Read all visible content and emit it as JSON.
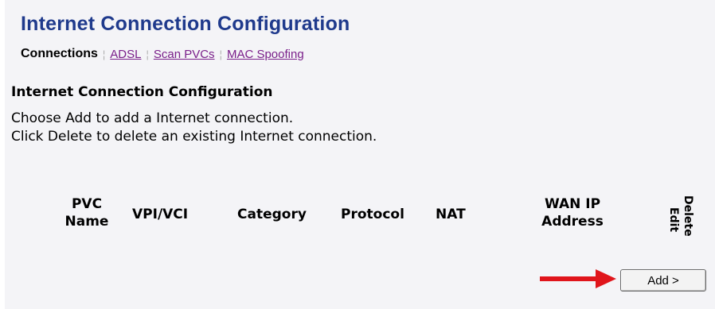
{
  "page": {
    "title": "Internet Connection Configuration"
  },
  "subnav": {
    "active": "Connections",
    "links": [
      "ADSL",
      "Scan PVCs",
      "MAC Spoofing"
    ]
  },
  "section": {
    "heading": "Internet Connection Configuration",
    "description": [
      "Choose Add to add a Internet connection.",
      "Click Delete to delete an existing Internet connection."
    ]
  },
  "table": {
    "headers": {
      "pvc_name": [
        "PVC",
        "Name"
      ],
      "vpi_vci": "VPI/VCI",
      "category": "Category",
      "protocol": "Protocol",
      "nat": "NAT",
      "wan_ip": [
        "WAN IP",
        "Address"
      ],
      "edit": "Edit",
      "delete": "Delete"
    },
    "rows": []
  },
  "actions": {
    "add_label": "Add >"
  },
  "colors": {
    "title": "#1f3a8c",
    "link": "#7a1f8a",
    "arrow": "#e0151b",
    "background": "#f4f4f7"
  },
  "icons": {
    "pointer": "right-arrow-icon"
  }
}
